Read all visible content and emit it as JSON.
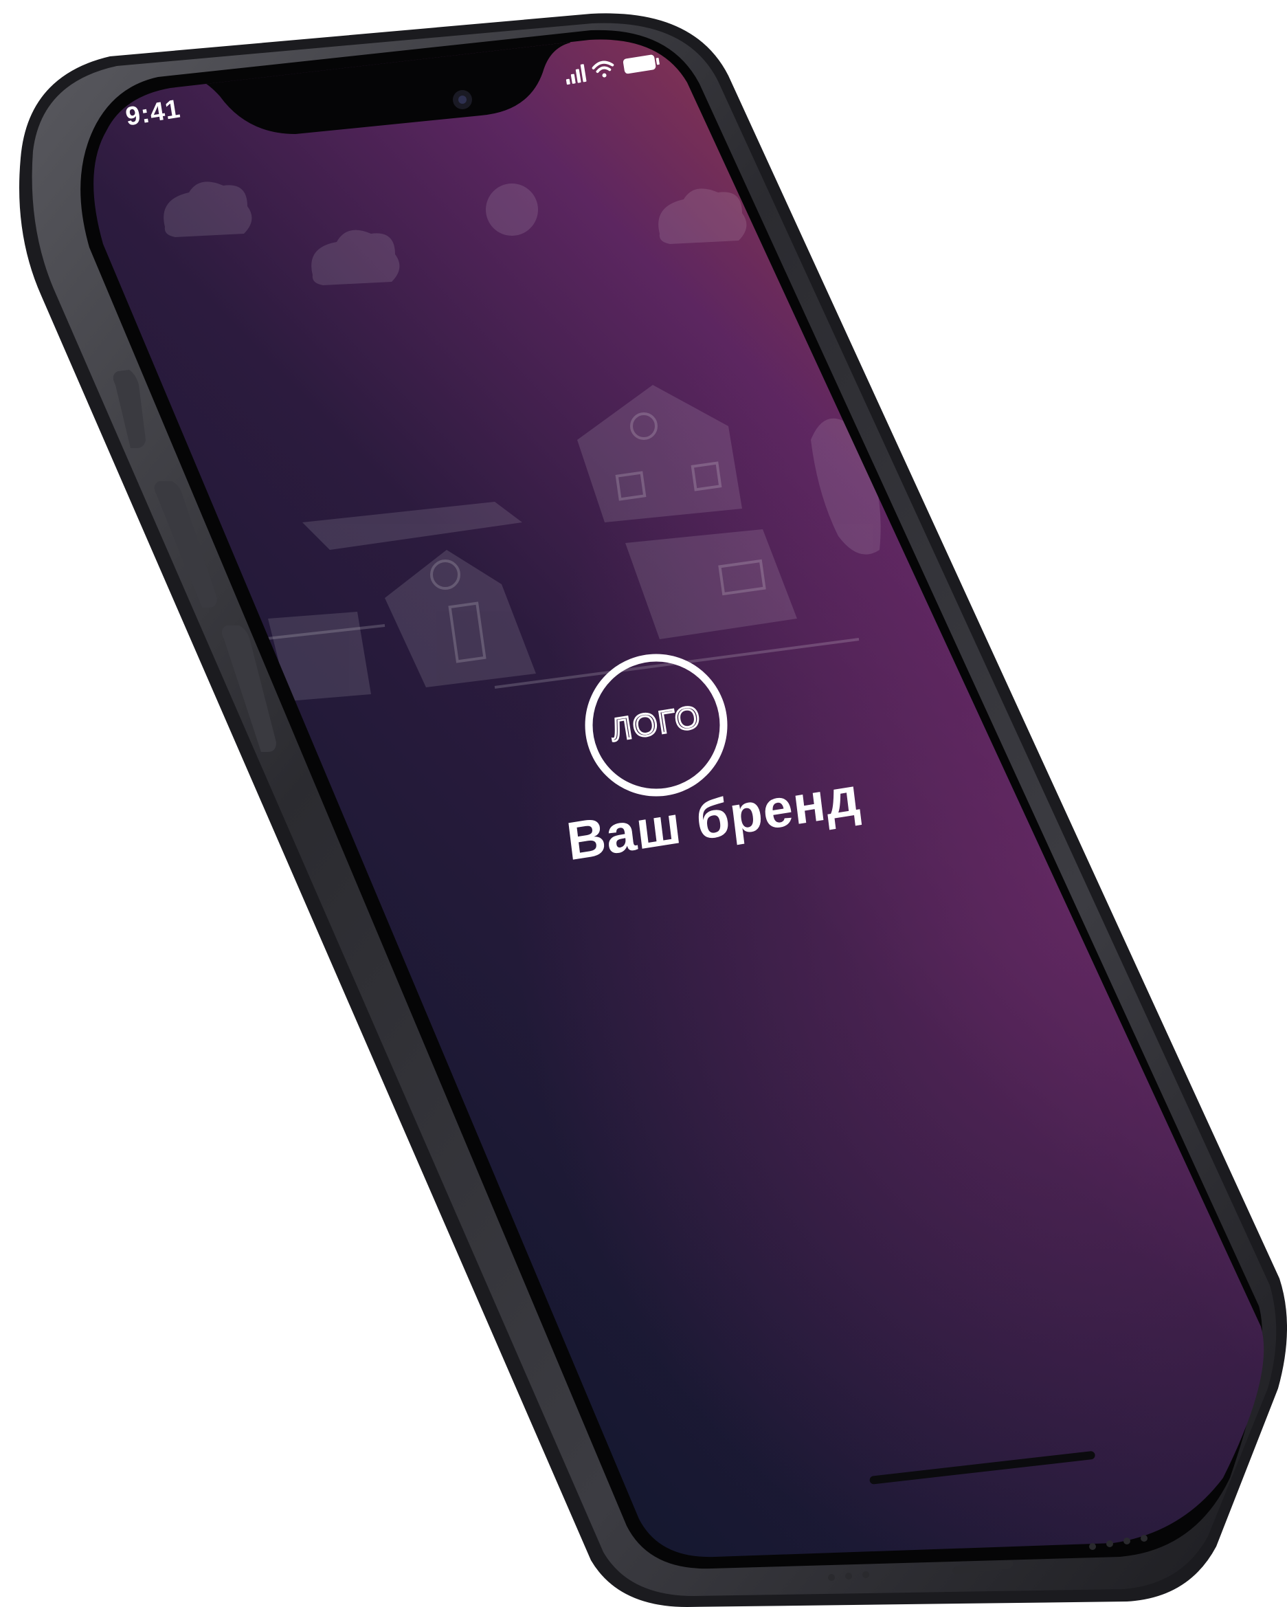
{
  "status_bar": {
    "time": "9:41",
    "icons": [
      "signal-icon",
      "wifi-icon",
      "battery-icon"
    ]
  },
  "logo": {
    "text": "ЛОГО"
  },
  "brand": {
    "name": "Ваш бренд"
  },
  "colors": {
    "screen_dark": "#171a2e",
    "screen_purple": "#5e2560",
    "screen_orange": "#c0603a",
    "frame": "#2a2a2e",
    "text": "#ffffff"
  }
}
